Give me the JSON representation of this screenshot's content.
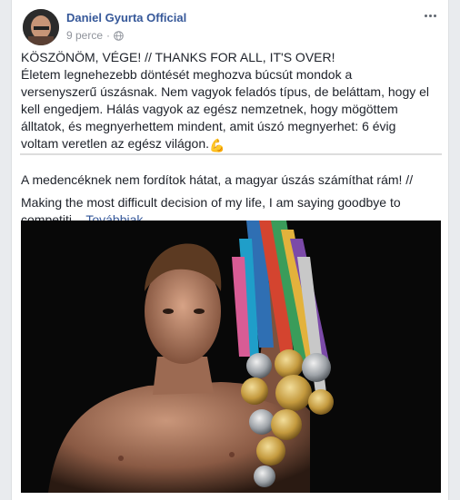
{
  "post": {
    "author": "Daniel Gyurta Official",
    "timestamp": "9 perce",
    "separator": "·",
    "privacy_icon": "globe-icon",
    "more_icon": "ellipsis-icon",
    "paragraph1_lines": [
      "KÖSZÖNÖM, VÉGE! // THANKS FOR ALL, IT'S OVER!",
      "Életem legnehezebb döntését meghozva búcsút mondok a",
      "versenyszerű úszásnak. Nem vagyok feladós típus, de beláttam, hogy el",
      "kell engedjem. Hálás vagyok az egész nemzetnek, hogy mögöttem",
      "álltatok, és megnyerhettem mindent, amit úszó megnyerhet: 6 évig",
      "voltam veretlen az egész világon.",
      "A medencéknek nem fordítok hátat, a magyar úszás számíthat rám! //"
    ],
    "emoji_muscle": "💪",
    "flag_icon": "hungary-flag-icon",
    "paragraph2_lines": [
      "Making the most difficult decision of my life, I am saying goodbye to",
      "competiti..."
    ],
    "see_more": "Továbbiak"
  },
  "colors": {
    "link": "#365899",
    "text": "#1d2129",
    "meta": "#90949c",
    "flag_red": "#cd2a3e",
    "flag_white": "#ffffff",
    "flag_green": "#436f4d"
  }
}
